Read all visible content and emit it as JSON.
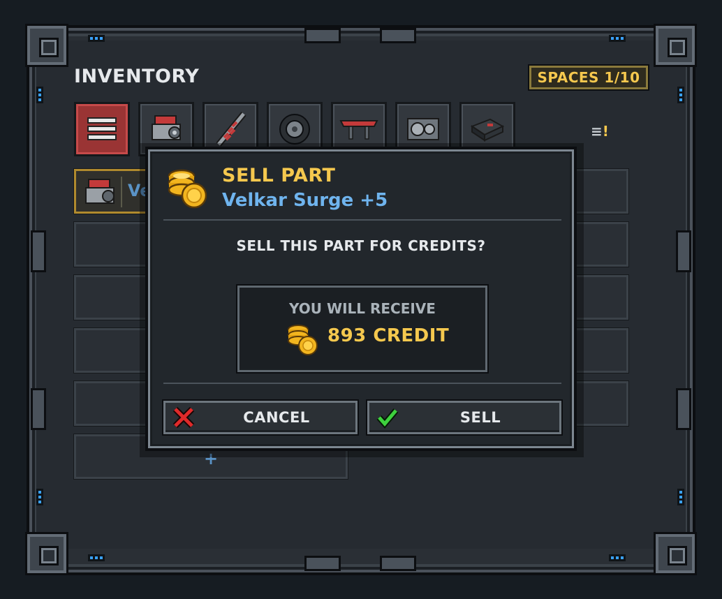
{
  "inventory": {
    "title": "INVENTORY",
    "spaces": "SPACES 1/10",
    "tabs": [
      {
        "name": "all",
        "icon": "list-icon",
        "active": true
      },
      {
        "name": "engine",
        "icon": "engine-icon",
        "active": false
      },
      {
        "name": "suspension",
        "icon": "shock-absorber-icon",
        "active": false
      },
      {
        "name": "tires",
        "icon": "tire-icon",
        "active": false
      },
      {
        "name": "aero",
        "icon": "spoiler-icon",
        "active": false
      },
      {
        "name": "transmission",
        "icon": "gearbox-icon",
        "active": false
      },
      {
        "name": "ecu",
        "icon": "ecu-icon",
        "active": false
      }
    ],
    "sort_icon": "sort-icon",
    "selected_item_label": "Ve",
    "add_slot_label": "+"
  },
  "dialog": {
    "title": "SELL PART",
    "part_name": "Velkar Surge +5",
    "question": "SELL THIS PART FOR CREDITS?",
    "receive_label": "YOU WILL RECEIVE",
    "credit_text": "893 CREDIT",
    "cancel_label": "CANCEL",
    "sell_label": "SELL"
  },
  "colors": {
    "gold": "#f5c84e",
    "blue_text": "#6fb4ee",
    "active_tab": "#9a3434",
    "led": "#3aa2ff"
  }
}
